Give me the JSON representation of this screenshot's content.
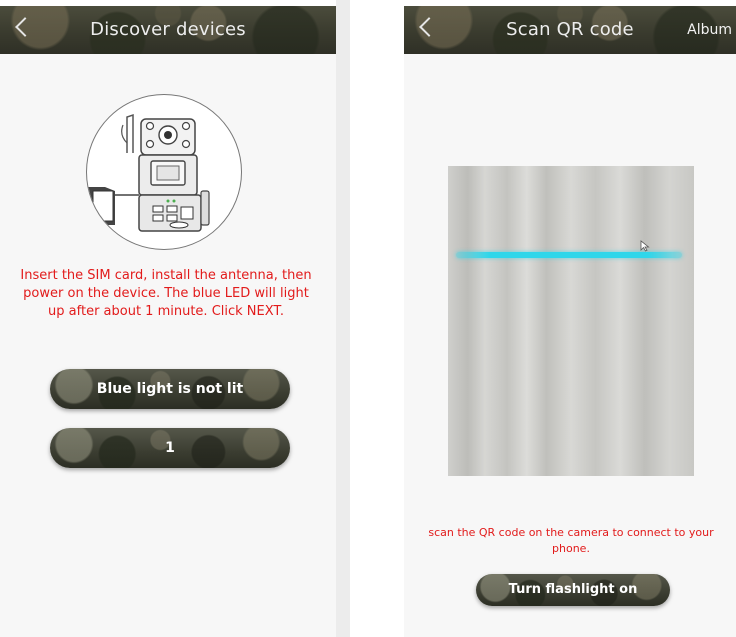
{
  "left_screen": {
    "title": "Discover devices",
    "back_icon": "chevron-left-icon",
    "illustration_icon": "trail-camera-illustration",
    "instruction": "Insert the SIM card, install the antenna, then power on the device. The blue LED will light up after about 1 minute. Click NEXT.",
    "buttons": {
      "blue_light_not_lit": "Blue light is not lit",
      "one": "1"
    }
  },
  "right_screen": {
    "title": "Scan QR code",
    "back_icon": "chevron-left-icon",
    "album_label": "Album",
    "hint": "scan the QR code on the camera to connect to your phone.",
    "flashlight_button": "Turn flashlight on"
  },
  "colors": {
    "instruction_text": "#e21b1b",
    "scan_line": "#2fd6ea",
    "titlebar": "#3a3b2e",
    "screen_background": "#f7f7f7"
  }
}
